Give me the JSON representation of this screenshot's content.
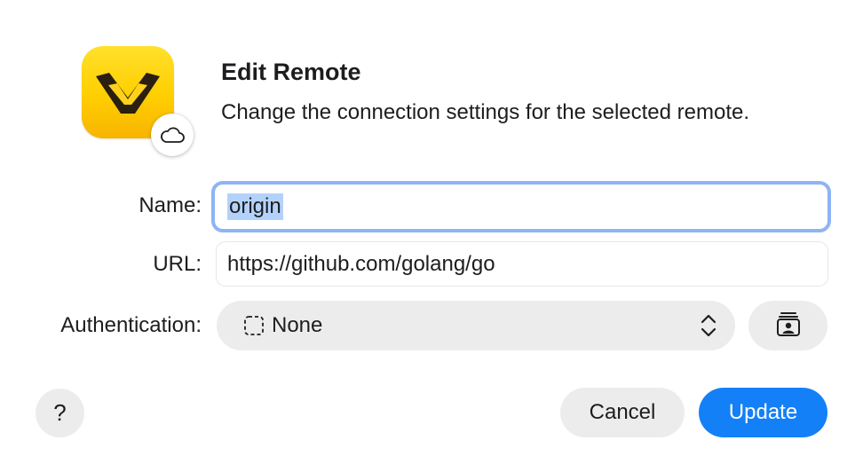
{
  "dialog": {
    "title": "Edit Remote",
    "subtitle": "Change the connection settings for the selected remote."
  },
  "app_icon": {
    "name": "app-icon",
    "badge_icon": "cloud-icon"
  },
  "form": {
    "name_label": "Name:",
    "name_value": "origin",
    "url_label": "URL:",
    "url_value": "https://github.com/golang/go",
    "auth_label": "Authentication:",
    "auth_value": "None",
    "auth_icon": "dashed-square-icon",
    "auth_chevron_icon": "chevron-up-down-icon",
    "keychain_icon": "keychain-icon"
  },
  "buttons": {
    "help_label": "?",
    "cancel_label": "Cancel",
    "update_label": "Update"
  },
  "colors": {
    "accent": "#1480f7",
    "focus_ring": "#8fb4f5",
    "selection": "#b3d2fb",
    "button_gray": "#ececec",
    "icon_yellow": "#ffce00"
  }
}
